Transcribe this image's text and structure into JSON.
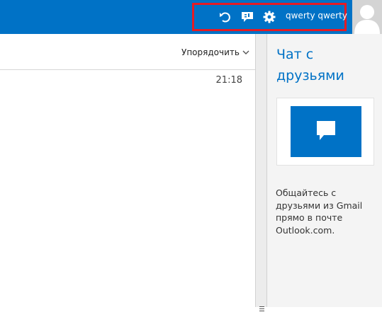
{
  "header": {
    "username": "qwerty qwerty",
    "icons": [
      "undo-icon",
      "feedback-icon",
      "gear-icon"
    ],
    "accent_color": "#0072c6",
    "highlight_color": "#e51b24"
  },
  "mail_list": {
    "sort_label": "Упорядочить",
    "items": [
      {
        "time": "21:18"
      }
    ]
  },
  "side_panel": {
    "title": "Чат с друзьями",
    "description": "Общайтесь с друзьями из Gmail прямо в почте Outlook.com."
  }
}
